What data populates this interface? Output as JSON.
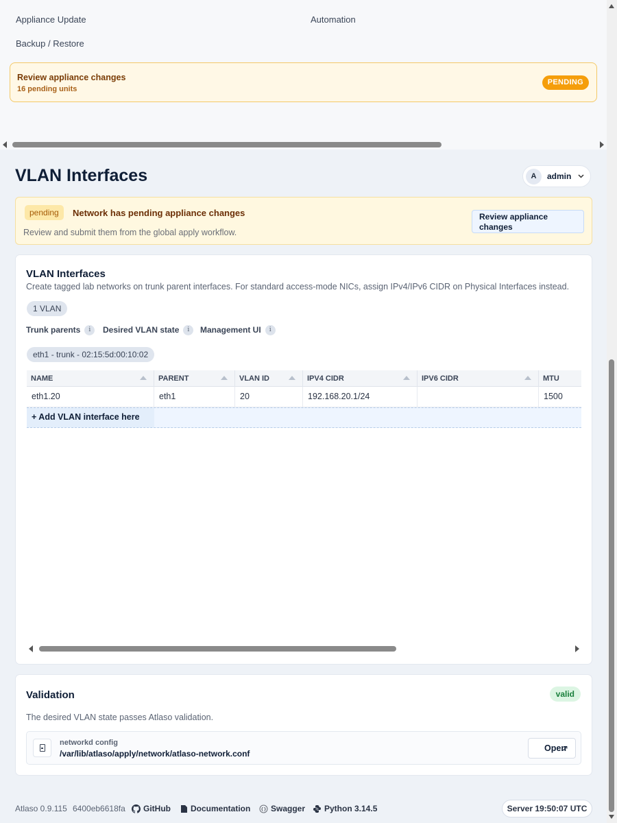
{
  "nav": {
    "appliance_update": "Appliance Update",
    "automation": "Automation",
    "backup_restore": "Backup / Restore"
  },
  "pending_banner": {
    "title": "Review appliance changes",
    "subtitle": "16 pending units",
    "badge": "PENDING"
  },
  "page": {
    "title": "VLAN Interfaces"
  },
  "user": {
    "avatar_letter": "A",
    "name": "admin"
  },
  "network_banner": {
    "chip": "pending",
    "headline": "Network has pending appliance changes",
    "subtext": "Review and submit them from the global apply workflow.",
    "button": "Review appliance changes"
  },
  "vlan_card": {
    "title": "VLAN Interfaces",
    "description": "Create tagged lab networks on trunk parent interfaces. For standard access-mode NICs, assign IPv4/IPv6 CIDR on Physical Interfaces instead.",
    "count": "1 VLAN",
    "info": [
      "Trunk parents",
      "Desired VLAN state",
      "Management UI"
    ],
    "parent_chip": "eth1 - trunk - 02:15:5d:00:10:02",
    "columns": [
      "NAME",
      "PARENT",
      "VLAN ID",
      "IPV4 CIDR",
      "IPV6 CIDR",
      "MTU"
    ],
    "rows": [
      {
        "name": "eth1.20",
        "parent": "eth1",
        "vlan_id": "20",
        "ipv4": "192.168.20.1/24",
        "ipv6": "",
        "mtu": "1500"
      }
    ],
    "add_row": "+ Add VLAN interface here"
  },
  "validation": {
    "title": "Validation",
    "status": "valid",
    "description": "The desired VLAN state passes Atlaso validation.",
    "file_label": "networkd config",
    "file_path": "/var/lib/atlaso/apply/network/atlaso-network.conf",
    "open": "Open"
  },
  "footer": {
    "version": "Atlaso 0.9.115",
    "commit": "6400eb6618fa",
    "github": "GitHub",
    "documentation": "Documentation",
    "swagger": "Swagger",
    "python": "Python 3.14.5",
    "server_time": "Server 19:50:07 UTC"
  },
  "colors": {
    "accent_pending": "#f59e0b",
    "valid": "#1a7f3c",
    "title": "#0f1e36"
  }
}
